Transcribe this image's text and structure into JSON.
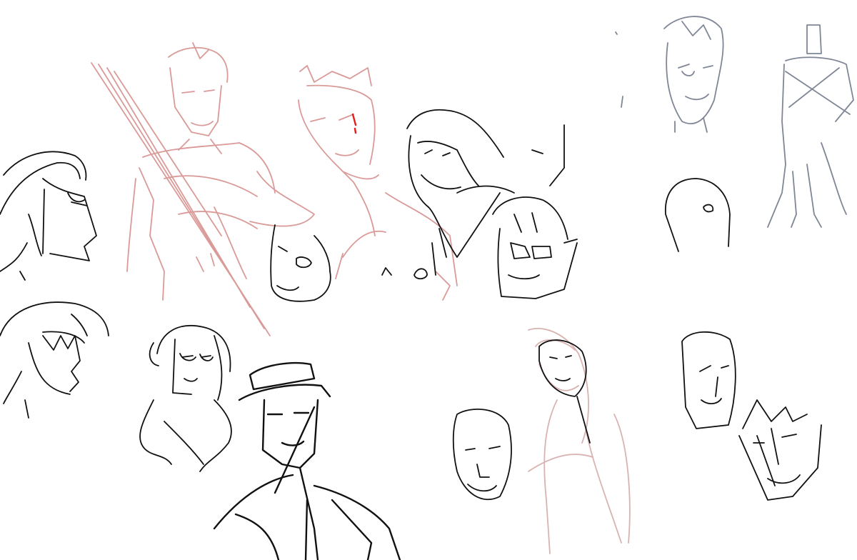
{
  "colors": {
    "background": "#ffffff",
    "ink_black": "#111111",
    "ink_red": "#d99a98",
    "ink_accent_red": "#e31b1b",
    "ink_gray": "#7f8696",
    "ink_pink": "#d9b3b1"
  },
  "sketches": [
    {
      "id": "left-profile-upper",
      "color": "ink_black"
    },
    {
      "id": "left-profile-lower",
      "color": "ink_black"
    },
    {
      "id": "red-figure-crossed",
      "color": "ink_red"
    },
    {
      "id": "red-bust-right",
      "color": "ink_red"
    },
    {
      "id": "black-face-mid",
      "color": "ink_black"
    },
    {
      "id": "long-hair-head",
      "color": "ink_black"
    },
    {
      "id": "glasses-man",
      "color": "ink_black"
    },
    {
      "id": "curly-woman",
      "color": "ink_black"
    },
    {
      "id": "hat-man",
      "color": "ink_black"
    },
    {
      "id": "bald-face",
      "color": "ink_black"
    },
    {
      "id": "pink-figure",
      "color": "ink_pink"
    },
    {
      "id": "gray-head",
      "color": "ink_gray"
    },
    {
      "id": "gray-standing-figure",
      "color": "ink_gray"
    },
    {
      "id": "egg-head",
      "color": "ink_black"
    },
    {
      "id": "two-faces-right",
      "color": "ink_black"
    }
  ]
}
